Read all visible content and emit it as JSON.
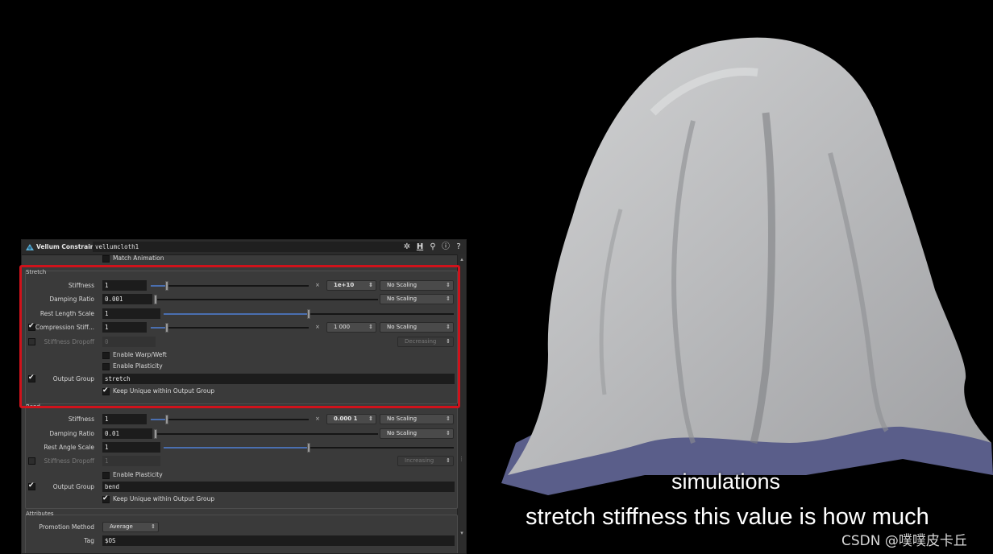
{
  "panel": {
    "node_type": "Vellum Constraints",
    "node_name": "vellumcloth1",
    "toolbar_icons": [
      "gear-icon",
      "help-h-icon",
      "search-icon",
      "info-icon",
      "question-icon"
    ],
    "match_animation_label": "Match Animation",
    "stretch": {
      "title": "Stretch",
      "stiffness_label": "Stiffness",
      "stiffness_value": "1",
      "stiffness_slider": 0.1,
      "stiffness_multiplier": "1e+10",
      "stiffness_scaling": "No Scaling",
      "damping_label": "Damping Ratio",
      "damping_value": "0.001",
      "damping_slider": 0.0,
      "damping_scaling": "No Scaling",
      "rest_length_label": "Rest Length Scale",
      "rest_length_value": "1",
      "rest_length_slider": 0.5,
      "compression_label": "Compression Stiff...",
      "compression_value": "1",
      "compression_slider": 0.1,
      "compression_multiplier": "1 000",
      "compression_scaling": "No Scaling",
      "compression_checked": true,
      "dropoff_label": "Stiffness Dropoff",
      "dropoff_value": "0",
      "dropoff_mode": "Decreasing",
      "warp_weft_label": "Enable Warp/Weft",
      "plasticity_label": "Enable Plasticity",
      "output_group_label": "Output Group",
      "output_group_value": "stretch",
      "keep_unique_label": "Keep Unique within Output Group"
    },
    "bend": {
      "title": "Bend",
      "stiffness_label": "Stiffness",
      "stiffness_value": "1",
      "stiffness_slider": 0.1,
      "stiffness_multiplier": "0.000 1",
      "stiffness_scaling": "No Scaling",
      "damping_label": "Damping Ratio",
      "damping_value": "0.01",
      "damping_slider": 0.0,
      "damping_scaling": "No Scaling",
      "rest_angle_label": "Rest Angle Scale",
      "rest_angle_value": "1",
      "rest_angle_slider": 0.5,
      "dropoff_label": "Stiffness Dropoff",
      "dropoff_value": "1",
      "dropoff_mode": "Increasing",
      "plasticity_label": "Enable Plasticity",
      "output_group_label": "Output Group",
      "output_group_value": "bend",
      "keep_unique_label": "Keep Unique within Output Group"
    },
    "attributes": {
      "title": "Attributes",
      "promotion_label": "Promotion Method",
      "promotion_value": "Average",
      "tag_label": "Tag",
      "tag_value": "$OS"
    },
    "highlight_color": "#d0121b"
  },
  "subtitles": {
    "line1": "simulations",
    "line2": "stretch stiffness this value is how much"
  },
  "watermark": "CSDN @噗噗皮卡丘"
}
